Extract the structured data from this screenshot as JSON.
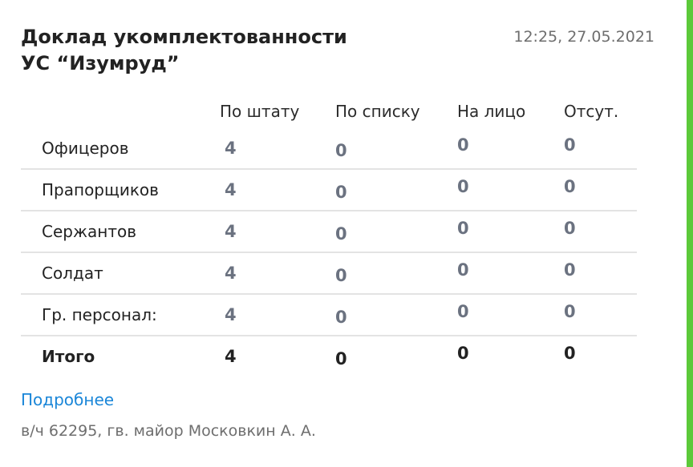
{
  "report": {
    "title_line1": "Доклад укомплектованности",
    "title_line2": "УС “Изумруд”",
    "timestamp": "12:25, 27.05.2021"
  },
  "table": {
    "headers": [
      "По штату",
      "По списку",
      "На лицо",
      "Отсут."
    ],
    "rows": [
      {
        "label": "Офицеров",
        "values": [
          "4",
          "0",
          "0",
          "0"
        ]
      },
      {
        "label": "Прапорщиков",
        "values": [
          "4",
          "0",
          "0",
          "0"
        ]
      },
      {
        "label": "Сержантов",
        "values": [
          "4",
          "0",
          "0",
          "0"
        ]
      },
      {
        "label": "Солдат",
        "values": [
          "4",
          "0",
          "0",
          "0"
        ]
      },
      {
        "label": "Гр. персонал:",
        "values": [
          "4",
          "0",
          "0",
          "0"
        ]
      }
    ],
    "total": {
      "label": "Итого",
      "values": [
        "4",
        "0",
        "0",
        "0"
      ]
    }
  },
  "links": {
    "more": "Подробнее"
  },
  "footer": {
    "signature": "в/ч 62295, гв. майор Московкин А. А."
  },
  "colors": {
    "accent": "#5cc93a",
    "link": "#1a86d8",
    "muted_value": "#6b7280"
  }
}
